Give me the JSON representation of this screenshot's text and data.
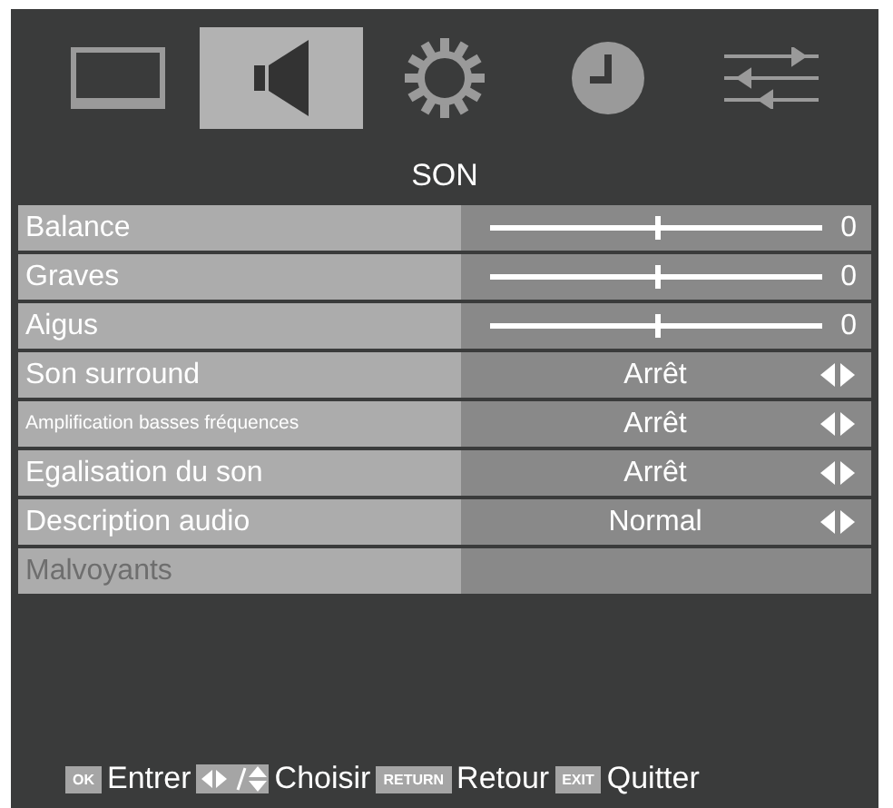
{
  "tabs": [
    {
      "kind": "picture",
      "selected": false
    },
    {
      "kind": "sound",
      "selected": true
    },
    {
      "kind": "setup",
      "selected": false
    },
    {
      "kind": "time",
      "selected": false
    },
    {
      "kind": "options",
      "selected": false
    }
  ],
  "title": "SON",
  "rows": [
    {
      "kind": "slider",
      "label": "Balance",
      "level": 0.5,
      "value": "0",
      "disabled": false
    },
    {
      "kind": "slider",
      "label": "Graves",
      "level": 0.5,
      "value": "0",
      "disabled": false
    },
    {
      "kind": "slider",
      "label": "Aigus",
      "level": 0.5,
      "value": "0",
      "disabled": false
    },
    {
      "kind": "option",
      "label": "Son surround",
      "value": "Arrêt",
      "disabled": false
    },
    {
      "kind": "option",
      "label": "Amplification basses fréquences",
      "small": true,
      "value": "Arrêt",
      "disabled": false
    },
    {
      "kind": "option",
      "label": "Egalisation du son",
      "value": "Arrêt",
      "disabled": false
    },
    {
      "kind": "option",
      "label": "Description audio",
      "value": "Normal",
      "disabled": false
    },
    {
      "kind": "empty",
      "label": "Malvoyants",
      "disabled": true
    }
  ],
  "footer": [
    {
      "kind": "key",
      "key": "OK",
      "label": "Entrer"
    },
    {
      "kind": "arrows",
      "label": "Choisir"
    },
    {
      "kind": "key",
      "key": "RETURN",
      "label": "Retour"
    },
    {
      "kind": "key",
      "key": "EXIT",
      "label": "Quitter"
    }
  ]
}
